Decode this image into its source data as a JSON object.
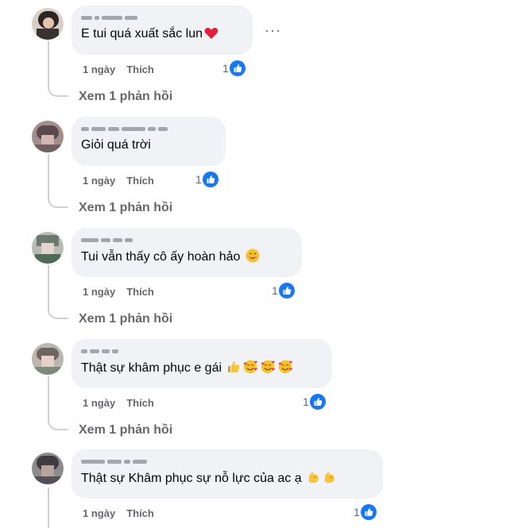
{
  "comments": [
    {
      "text": "E tui quá xuất sắc lun",
      "time": "1 ngày",
      "like": "Thích",
      "reactions": "1",
      "replies": "Xem 1 phản hồi"
    },
    {
      "text": "Giỏi quá trời",
      "time": "1 ngày",
      "like": "Thích",
      "reactions": "1",
      "replies": "Xem 1 phản hồi"
    },
    {
      "text": "Tui vẫn thấy cô ấy hoàn hảo",
      "time": "1 ngày",
      "like": "Thích",
      "reactions": "1",
      "replies": "Xem 1 phản hồi"
    },
    {
      "text": "Thật sự khâm phục e gái",
      "time": "1 ngày",
      "like": "Thích",
      "reactions": "1",
      "replies": "Xem 1 phản hồi"
    },
    {
      "text": "Thật sự Khâm phục sự nỗ lực của ac ạ",
      "time": "1 ngày",
      "like": "Thích",
      "reactions": "1"
    }
  ],
  "icons": {
    "like_reaction": "like-icon",
    "heart": "red-heart-emoji",
    "smile": "smiling-face-emoji",
    "thumbs": "thumbs-up-emoji",
    "hearts_face": "smiling-face-with-hearts-emoji",
    "muscle": "flexed-biceps-emoji",
    "more": "more-options-icon"
  },
  "colors": {
    "bubble": "#f0f2f5",
    "meta": "#65676b",
    "like_blue": "#1877f2",
    "thread": "#ced0d4"
  }
}
